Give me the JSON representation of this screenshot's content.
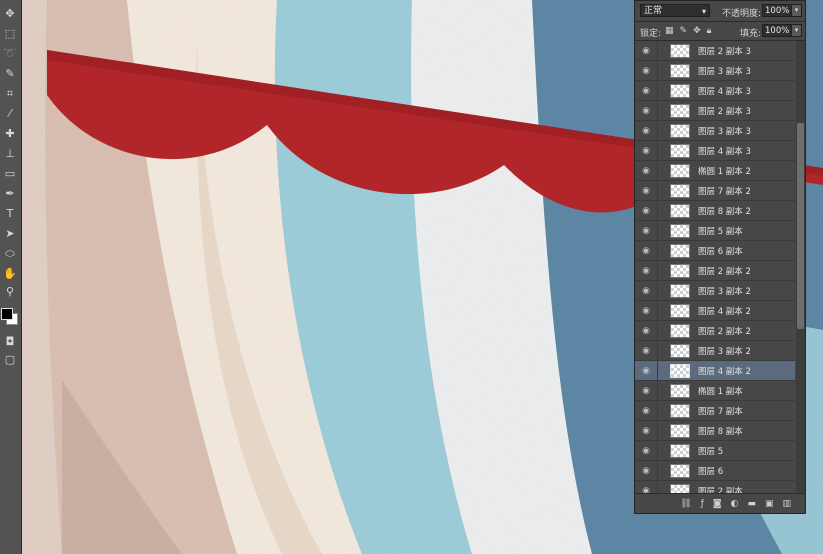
{
  "layers_panel": {
    "blend_mode": "正常",
    "opacity_label": "不透明度:",
    "opacity_value": "100%",
    "lock_label": "锁定:",
    "fill_label": "填充:",
    "fill_value": "100%",
    "layers": [
      {
        "name": "图层 2 副本 3",
        "selected": false
      },
      {
        "name": "图层 3 副本 3",
        "selected": false
      },
      {
        "name": "图层 4 副本 3",
        "selected": false
      },
      {
        "name": "图层 2 副本 3",
        "selected": false
      },
      {
        "name": "图层 3 副本 3",
        "selected": false
      },
      {
        "name": "图层 4 副本 3",
        "selected": false
      },
      {
        "name": "椭圆 1 副本 2",
        "selected": false
      },
      {
        "name": "图层 7 副本 2",
        "selected": false
      },
      {
        "name": "图层 8 副本 2",
        "selected": false
      },
      {
        "name": "图层 5 副本",
        "selected": false
      },
      {
        "name": "图层 6 副本",
        "selected": false
      },
      {
        "name": "图层 2 副本 2",
        "selected": false
      },
      {
        "name": "图层 3 副本 2",
        "selected": false
      },
      {
        "name": "图层 4 副本 2",
        "selected": false
      },
      {
        "name": "图层 2 副本 2",
        "selected": false
      },
      {
        "name": "图层 3 副本 2",
        "selected": false
      },
      {
        "name": "图层 4 副本 2",
        "selected": true
      },
      {
        "name": "椭圆 1 副本",
        "selected": false
      },
      {
        "name": "图层 7 副本",
        "selected": false
      },
      {
        "name": "图层 8 副本",
        "selected": false
      },
      {
        "name": "图层 5",
        "selected": false
      },
      {
        "name": "图层 6",
        "selected": false
      },
      {
        "name": "图层 2 副本",
        "selected": false
      }
    ]
  },
  "colors": {
    "panel_bg": "#474747",
    "selected_row": "#5b6a7d",
    "bunting_red": "#b5262b",
    "stripe_blue": "#9fcfdc",
    "stripe_dark_blue": "#5e88a6",
    "stripe_cream": "#f4ebe0"
  },
  "icons": {
    "toolbar": [
      "move-icon",
      "marquee-icon",
      "lasso-icon",
      "brush-icon",
      "crop-icon",
      "eyedropper-icon",
      "healing-icon",
      "stamp-icon",
      "history-brush-icon",
      "eraser-icon",
      "gradient-icon",
      "blur-icon",
      "dodge-icon",
      "pen-icon",
      "type-icon",
      "path-select-icon",
      "shape-icon",
      "hand-icon",
      "zoom-icon"
    ]
  }
}
